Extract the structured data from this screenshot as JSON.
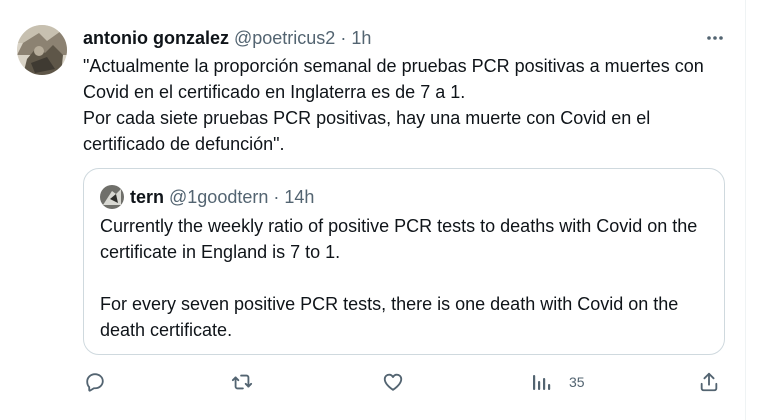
{
  "tweet": {
    "author_name": "antonio gonzalez",
    "author_handle": "@poetricus2",
    "separator": "·",
    "time": "1h",
    "text_lines": [
      "\"Actualmente la proporción semanal de pruebas PCR positivas a muertes con Covid en el certificado en Inglaterra es de 7 a 1.",
      "Por cada siete pruebas PCR positivas, hay una muerte con Covid en el certificado de defunción\"."
    ]
  },
  "quote": {
    "author_name": "tern",
    "author_handle": "@1goodtern",
    "separator": "·",
    "time": "14h",
    "paragraphs": [
      "Currently the weekly ratio of positive PCR tests to deaths with Covid on the certificate in England is 7 to 1.",
      "For every seven positive PCR tests, there is one death with Covid on the death certificate."
    ]
  },
  "actions": {
    "reply_icon": "reply-icon",
    "retweet_icon": "retweet-icon",
    "like_icon": "heart-icon",
    "views_icon": "views-icon",
    "views_count": "35",
    "share_icon": "share-icon",
    "more_icon": "more-icon"
  },
  "colors": {
    "text_primary": "#0f1419",
    "text_secondary": "#536471",
    "border": "#cfd9de"
  }
}
